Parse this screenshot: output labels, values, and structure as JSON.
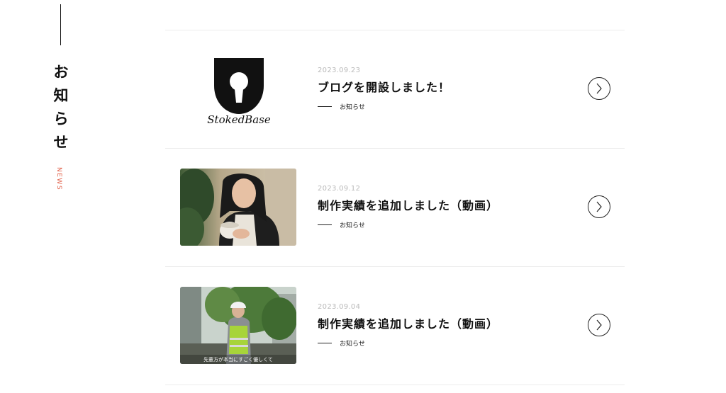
{
  "section": {
    "title_chars": [
      "お",
      "知",
      "ら",
      "せ"
    ],
    "subtitle": "NEWS",
    "accent_color": "#e0604a"
  },
  "news": [
    {
      "date": "2023.09.23",
      "title": "ブログを開設しました！",
      "category": "お知らせ",
      "thumb": "stokedbase-logo",
      "logo_text": "StokedBase"
    },
    {
      "date": "2023.09.12",
      "title": "制作実績を追加しました（動画）",
      "category": "お知らせ",
      "thumb": "woman-with-cup-photo"
    },
    {
      "date": "2023.09.04",
      "title": "制作実績を追加しました（動画）",
      "category": "お知らせ",
      "thumb": "worker-in-safety-vest-photo",
      "caption": "先輩方が本当にすごく優しくて"
    }
  ],
  "icons": {
    "arrow": "chevron-right-circle-icon"
  }
}
